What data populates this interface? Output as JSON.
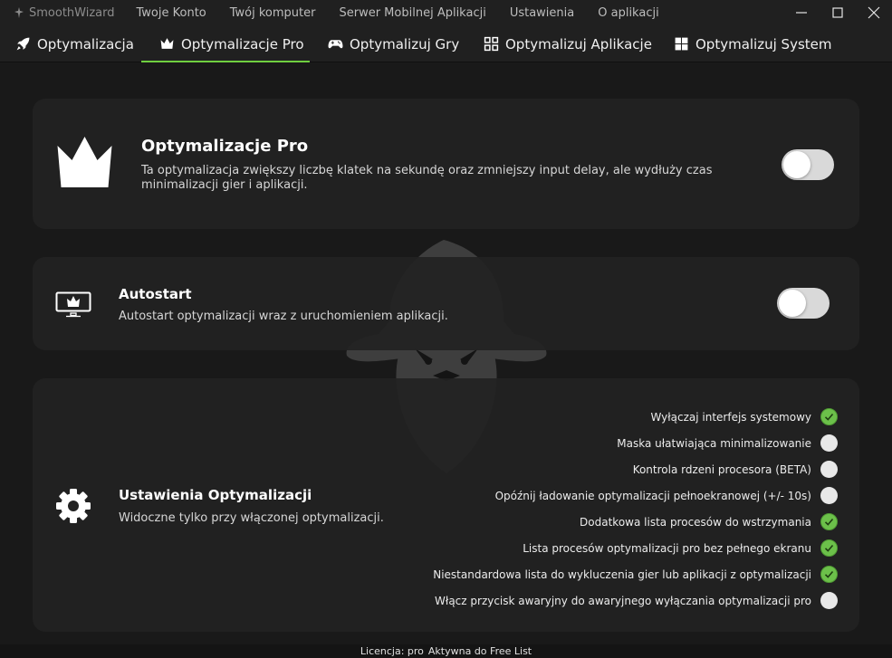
{
  "titlebar": {
    "app_name": "SmoothWizard",
    "app_icon": "wizard-logo-icon",
    "menu": [
      "Twoje Konto",
      "Twój komputer",
      "Serwer Mobilnej Aplikacji",
      "Ustawienia",
      "O aplikacji"
    ]
  },
  "window_controls": {
    "minimize_icon": "minimize-icon",
    "maximize_icon": "maximize-icon",
    "close_icon": "close-icon"
  },
  "tabs": [
    {
      "label": "Optymalizacja",
      "icon": "rocket-icon",
      "active": false
    },
    {
      "label": "Optymalizacje Pro",
      "icon": "crown-icon",
      "active": true
    },
    {
      "label": "Optymalizuj Gry",
      "icon": "gamepad-icon",
      "active": false
    },
    {
      "label": "Optymalizuj Aplikacje",
      "icon": "grid-icon",
      "active": false
    },
    {
      "label": "Optymalizuj System",
      "icon": "windows-icon",
      "active": false
    }
  ],
  "pro_card": {
    "icon": "crown-icon",
    "title": "Optymalizacje Pro",
    "description": "Ta optymalizacja zwiększy liczbę klatek na sekundę oraz zmniejszy input delay, ale wydłuży czas minimalizacji gier i aplikacji.",
    "enabled": false
  },
  "autostart_card": {
    "icon": "monitor-crown-icon",
    "title": "Autostart",
    "description": "Autostart optymalizacji wraz z uruchomieniem aplikacji.",
    "enabled": false
  },
  "settings_card": {
    "icon": "gear-icon",
    "title": "Ustawienia Optymalizacji",
    "description": "Widoczne tylko przy włączonej optymalizacji.",
    "options": [
      {
        "label": "Wyłączaj interfejs systemowy",
        "checked": true
      },
      {
        "label": "Maska ułatwiająca minimalizowanie",
        "checked": false
      },
      {
        "label": "Kontrola rdzeni procesora (BETA)",
        "checked": false
      },
      {
        "label": "Opóźnij ładowanie optymalizacji pełnoekranowej (+/- 10s)",
        "checked": false
      },
      {
        "label": "Dodatkowa lista procesów do wstrzymania",
        "checked": true
      },
      {
        "label": "Lista procesów optymalizacji pro bez pełnego ekranu",
        "checked": true
      },
      {
        "label": "Niestandardowa lista do wykluczenia gier lub aplikacji z optymalizacji",
        "checked": true
      },
      {
        "label": "Włącz przycisk awaryjny do awaryjnego wyłączania optymalizacji pro",
        "checked": false
      }
    ]
  },
  "status": {
    "license_label": "Licencja: pro",
    "license_status": "Aktywna do Free List"
  },
  "colors": {
    "accent": "#6fcf3f",
    "check_on": "#6cc04a",
    "background": "#191919",
    "card": "#222222"
  }
}
